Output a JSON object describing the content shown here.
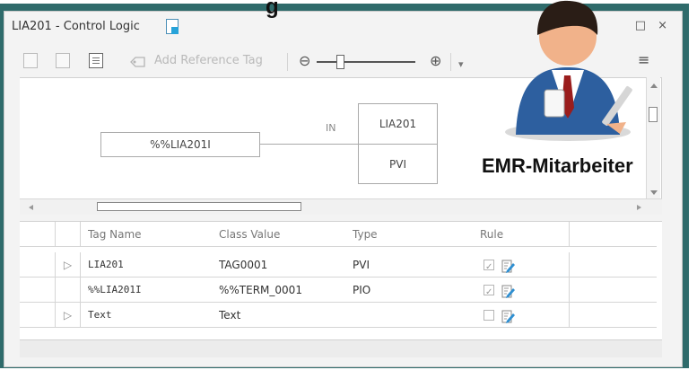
{
  "overlay": {
    "heading_fragment": "g",
    "avatar_caption": "EMR-Mitarbeiter"
  },
  "window": {
    "title": "LIA201 - Control Logic",
    "maximize_glyph": "□",
    "close_glyph": "×"
  },
  "toolbar": {
    "add_reference_tag_label": "Add Reference Tag",
    "zoom_out_glyph": "⊖",
    "zoom_in_glyph": "⊕",
    "overflow_glyph": "≡"
  },
  "diagram": {
    "source_tag": "%%LIA201I",
    "connector_label": "IN",
    "block_name": "LIA201",
    "block_type": "PVI"
  },
  "grid": {
    "headers": {
      "tag_name": "Tag Name",
      "class_value": "Class Value",
      "type": "Type",
      "rule": "Rule"
    },
    "rows": [
      {
        "expand": "▷",
        "tag_name": "LIA201",
        "class_value": "TAG0001",
        "type": "PVI",
        "rule_checked": true
      },
      {
        "expand": "",
        "tag_name": "%%LIA201I",
        "class_value": "%%TERM_0001",
        "type": "PIO",
        "rule_checked": true
      },
      {
        "expand": "▷",
        "tag_name": "Text",
        "class_value": "Text",
        "type": "",
        "rule_checked": false
      }
    ]
  },
  "colors": {
    "frame": "#2f6b6b",
    "accent_icon": "#27a3d9"
  }
}
